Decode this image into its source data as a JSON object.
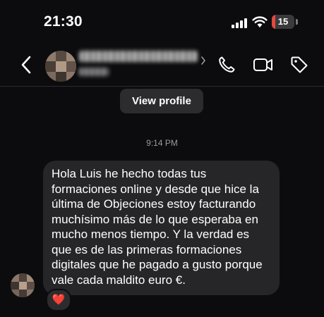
{
  "status_bar": {
    "time": "21:30",
    "battery_level": "15",
    "battery_fraction": 0.15,
    "battery_color": "#e5483d"
  },
  "header": {
    "back_icon": "chevron-left-icon",
    "actions": [
      "phone-icon",
      "video-call-icon",
      "tag-icon"
    ]
  },
  "view_profile_label": "View profile",
  "timestamp": "9:14 PM",
  "message": {
    "lines": [
      "Hola Luis he hecho todas tus",
      "formaciones online y desde que hice la",
      "última de Objeciones estoy facturando",
      "muchísimo más de lo que esperaba en",
      "mucho menos tiempo. Y la verdad es",
      "que es de las primeras formaciones",
      "digitales que he pagado a gusto porque",
      "vale cada maldito euro €."
    ],
    "reaction": "❤️"
  },
  "colors": {
    "background": "#0c0c0e",
    "bubble": "#262628",
    "button": "#2c2c2e",
    "muted_text": "#9a9aa0"
  }
}
